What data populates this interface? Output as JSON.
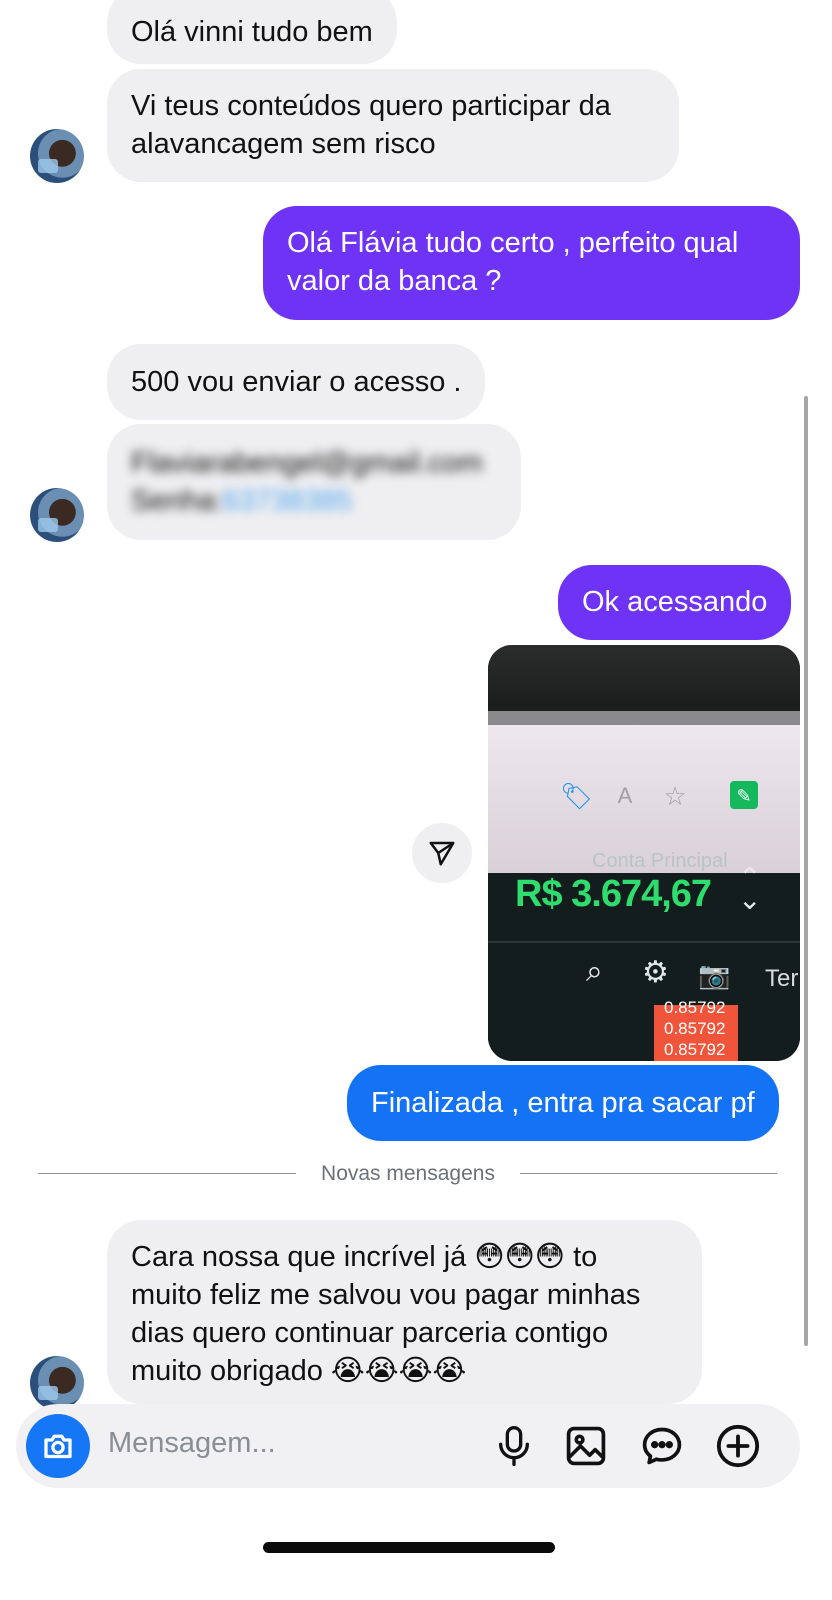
{
  "conversation": {
    "messages": [
      {
        "id": "m1",
        "direction": "incoming",
        "text": "Olá vinni tudo bem"
      },
      {
        "id": "m2",
        "direction": "incoming",
        "line1": "Vi teus conteúdos quero participar da",
        "line2": "alavancagem sem risco"
      },
      {
        "id": "m3",
        "direction": "outgoing",
        "line1": "Olá Flávia tudo certo , perfeito qual",
        "line2": "valor da banca ?"
      },
      {
        "id": "m4",
        "direction": "incoming",
        "text": "500 vou enviar o acesso ."
      },
      {
        "id": "m5",
        "direction": "incoming",
        "blurred": true,
        "line1": "Flaviarabengel@gmail.com",
        "label": "Senha:",
        "secret": "63738385"
      },
      {
        "id": "m6",
        "direction": "outgoing",
        "text": "Ok acessando"
      },
      {
        "id": "m8",
        "direction": "outgoing",
        "text": "Finalizada , entra pra sacar pf"
      },
      {
        "id": "m9",
        "direction": "incoming",
        "line1": "Cara nossa que incrível já 😳😳😳 to",
        "line2": "muito feliz me salvou vou pagar minhas",
        "line3": "dias quero continuar parceria contigo",
        "line4": "muito obrigado 😭😭😭😭"
      }
    ],
    "photo": {
      "account_label": "Conta Principal",
      "balance": "R$ 3.674,67",
      "partial_label": "Ter",
      "prices": [
        "0.85792",
        "0.85792",
        "0.85792"
      ]
    },
    "new_messages_label": "Novas mensagens"
  },
  "composer": {
    "placeholder": "Mensagem..."
  },
  "colors": {
    "outgoing_purple": "#6e33f5",
    "outgoing_blue": "#1472f5",
    "incoming_bubble": "#efeff1",
    "balance_green": "#2fdc6e"
  },
  "icons": [
    "camera-icon",
    "microphone-icon",
    "gallery-icon",
    "sticker-icon",
    "plus-icon",
    "send-arrow-icon"
  ]
}
